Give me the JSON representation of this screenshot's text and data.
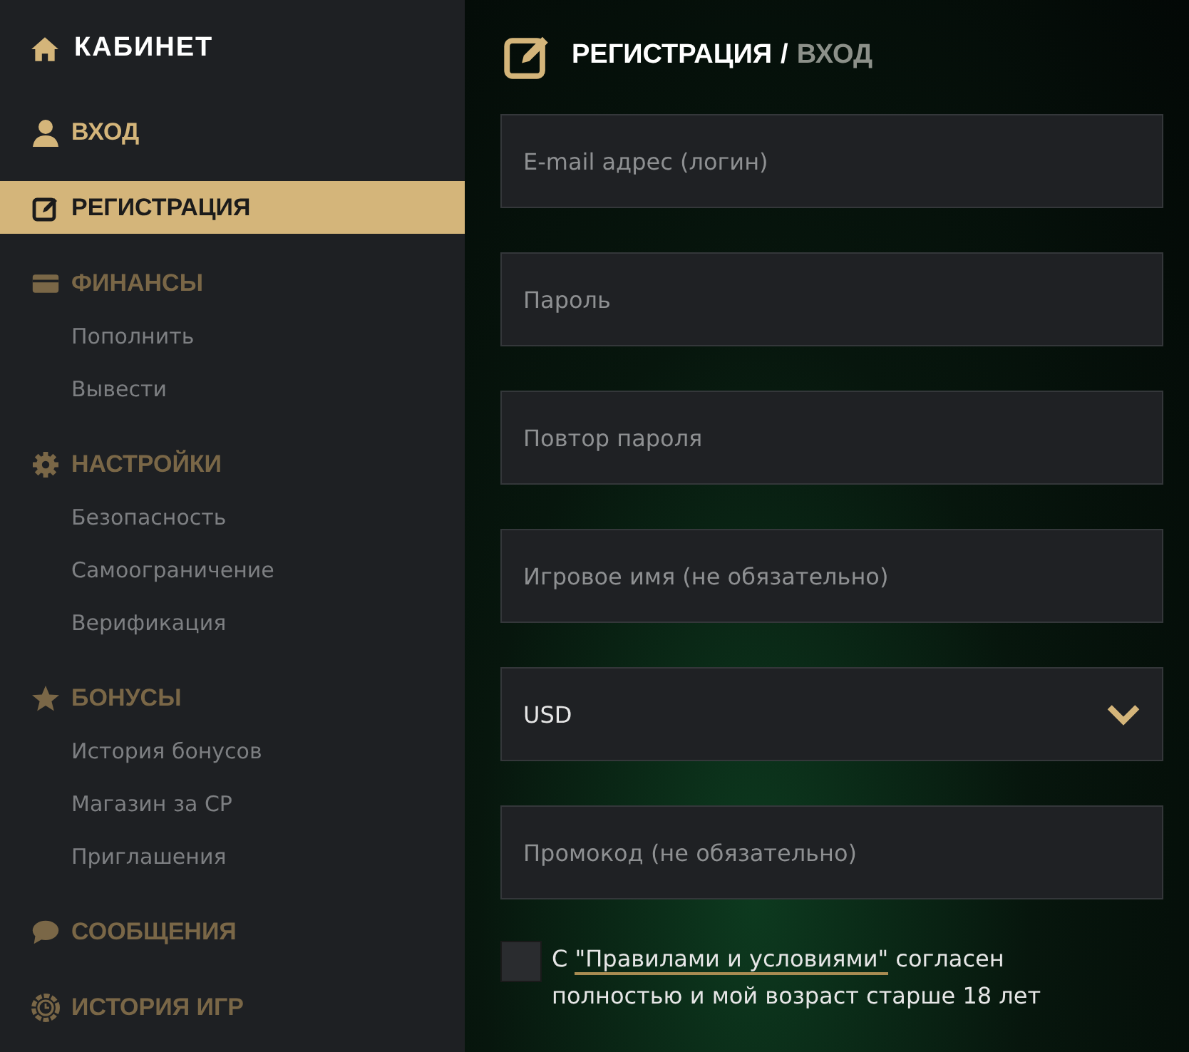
{
  "sidebar": {
    "title": "КАБИНЕТ",
    "items": [
      {
        "label": "ВХОД",
        "selected": false,
        "dimmed": false
      },
      {
        "label": "РЕГИСТРАЦИЯ",
        "selected": true,
        "dimmed": false
      },
      {
        "label": "ФИНАНСЫ",
        "selected": false,
        "dimmed": true,
        "children": [
          {
            "label": "Пополнить",
            "selected": false
          },
          {
            "label": "Вывести",
            "selected": false
          }
        ]
      },
      {
        "label": "НАСТРОЙКИ",
        "selected": false,
        "dimmed": true,
        "children": [
          {
            "label": "Безопасность",
            "selected": false
          },
          {
            "label": "Самоограничение",
            "selected": false
          },
          {
            "label": "Верификация",
            "selected": false
          }
        ]
      },
      {
        "label": "БОНУСЫ",
        "selected": false,
        "dimmed": true,
        "children": [
          {
            "label": "История бонусов",
            "selected": false
          },
          {
            "label": "Магазин за CP",
            "selected": false
          },
          {
            "label": "Приглашения",
            "selected": false
          }
        ]
      },
      {
        "label": "СООБЩЕНИЯ",
        "selected": false,
        "dimmed": true
      },
      {
        "label": "ИСТОРИЯ ИГР",
        "selected": false,
        "dimmed": true
      }
    ]
  },
  "form": {
    "title": "РЕГИСТРАЦИЯ",
    "separator": "/",
    "alt_title": "ВХОД",
    "fields": [
      {
        "kind": "text",
        "placeholder": "E-mail адрес (логин)"
      },
      {
        "kind": "text",
        "placeholder": "Пароль"
      },
      {
        "kind": "text",
        "placeholder": "Повтор пароля"
      },
      {
        "kind": "text",
        "placeholder": "Игровое имя (не обязательно)"
      },
      {
        "kind": "select",
        "value": "USD"
      },
      {
        "kind": "text",
        "placeholder": "Промокод (не обязательно)"
      }
    ],
    "agreement": {
      "checked": false,
      "before": "С",
      "link": "\"Правилами и условиями\"",
      "after": "согласен полностью и мой возраст старше 18 лет"
    }
  }
}
